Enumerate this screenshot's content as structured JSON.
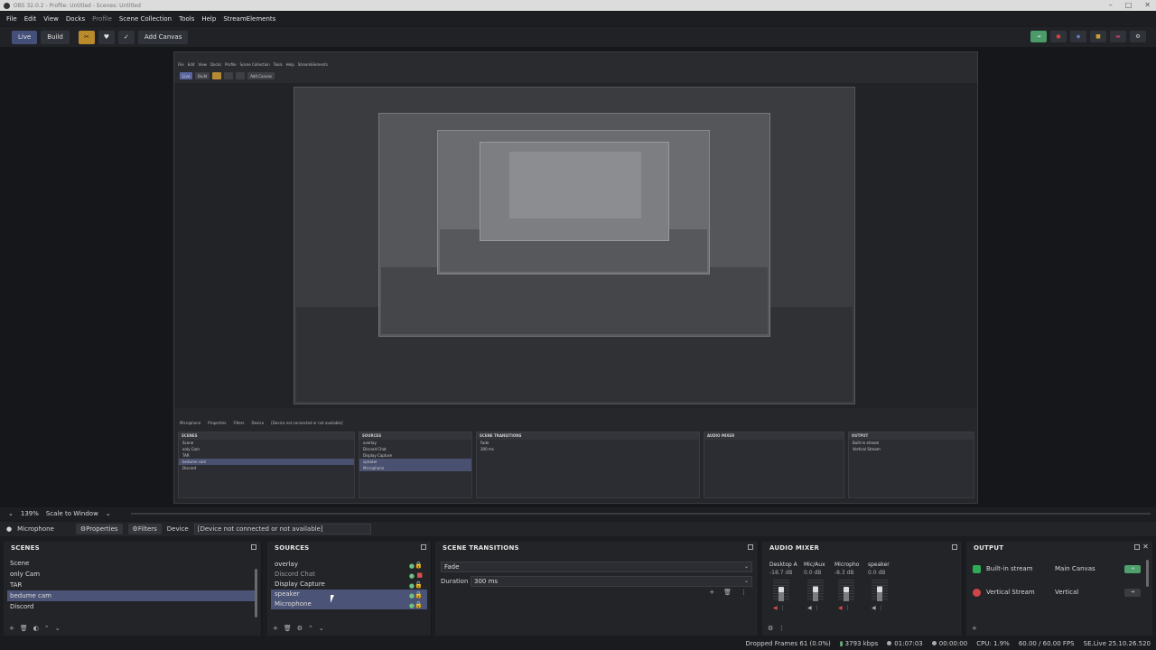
{
  "window": {
    "title": "OBS 32.0.2 - Profile: Untitled - Scenes: Untitled"
  },
  "menu": [
    "File",
    "Edit",
    "View",
    "Docks",
    "Profile",
    "Scene Collection",
    "Tools",
    "Help",
    "StreamElements"
  ],
  "toolbar": {
    "live_label": "Live",
    "build_label": "Build",
    "add_canvas_label": "Add Canvas"
  },
  "scale": {
    "zoom": "139%",
    "mode": "Scale to Window"
  },
  "properties_bar": {
    "source_name": "Microphone",
    "properties_label": "Properties",
    "filters_label": "Filters",
    "device_label": "Device",
    "device_value": "[Device not connected or not available]"
  },
  "scenes": {
    "title": "SCENES",
    "items": [
      "Scene",
      "only Cam",
      "TAR",
      "bedume cam",
      "Discord"
    ],
    "selected_index": 3
  },
  "sources": {
    "title": "SOURCES",
    "items": [
      {
        "name": "overlay",
        "lock": "locked"
      },
      {
        "name": "Discord Chat",
        "lock": "red"
      },
      {
        "name": "Display Capture",
        "lock": "unlocked"
      },
      {
        "name": "speaker",
        "lock": "locked"
      },
      {
        "name": "Microphone",
        "lock": "locked"
      }
    ]
  },
  "transitions": {
    "title": "SCENE TRANSITIONS",
    "transition": "Fade",
    "duration_label": "Duration",
    "duration_value": "300 ms"
  },
  "mixer": {
    "title": "AUDIO MIXER",
    "channels": [
      {
        "name": "Desktop A",
        "db": "-18.7 dB",
        "level": 0.55
      },
      {
        "name": "Mic/Aux",
        "db": "0.0 dB",
        "level": 0.7
      },
      {
        "name": "Micropho",
        "db": "-8.3 dB",
        "level": 0.6
      },
      {
        "name": "speaker",
        "db": "0.0 dB",
        "level": 0.7
      }
    ]
  },
  "output": {
    "title": "OUTPUT",
    "rows": [
      {
        "name": "Built-in stream",
        "canvas": "Main Canvas",
        "active": true
      },
      {
        "name": "Vertical Stream",
        "canvas": "Vertical",
        "active": false
      }
    ]
  },
  "status": {
    "dropped": "Dropped Frames 61 (0.0%)",
    "bitrate": "3793 kbps",
    "rec_time": "01:07:03",
    "stream_time": "00:00:00",
    "cpu": "CPU: 1.9%",
    "fps": "60.00 / 60.00 FPS",
    "se": "SE.Live 25.10.26.520"
  },
  "colors": {
    "accent": "#4b5376",
    "green": "#4ea06c",
    "orange": "#bb8a2b"
  }
}
